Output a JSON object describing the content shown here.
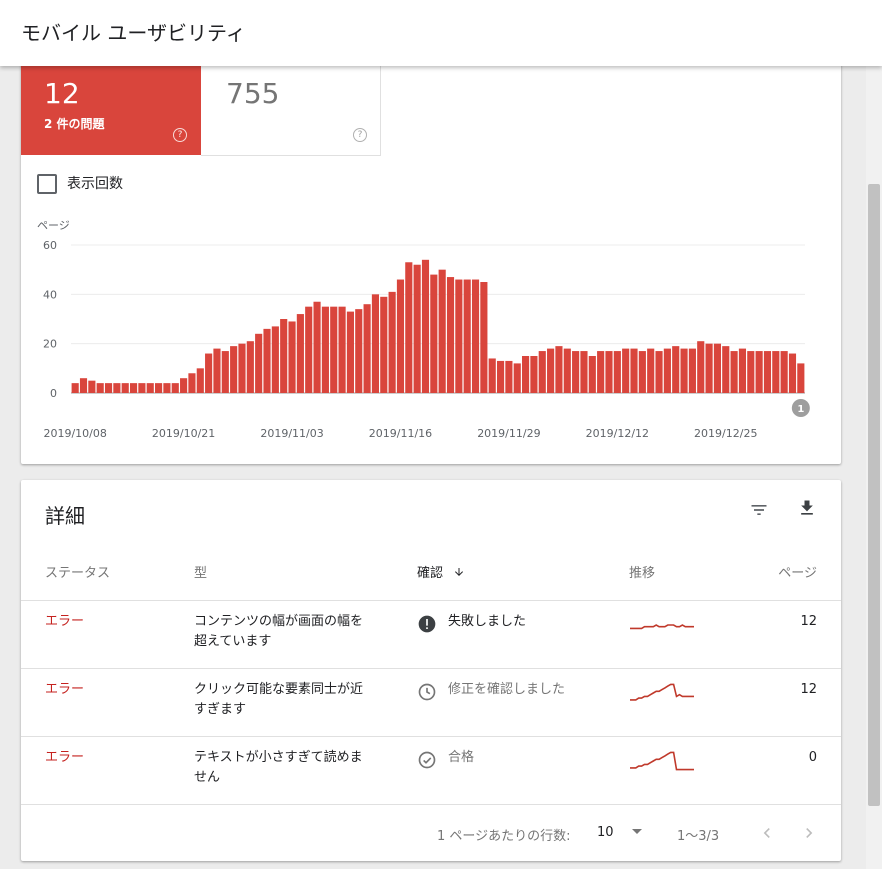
{
  "header": {
    "title": "モバイル ユーザビリティ"
  },
  "summary": {
    "error_count": "12",
    "error_label": "2 件の問題",
    "valid_count": "755",
    "help_glyph": "?"
  },
  "toggle": {
    "impressions_label": "表示回数",
    "checked": false
  },
  "chart_data": {
    "type": "bar",
    "ylabel": "ページ",
    "ylim": [
      0,
      60
    ],
    "yticks": [
      0,
      20,
      40,
      60
    ],
    "xticks": [
      {
        "label": "2019/10/08",
        "index": 0
      },
      {
        "label": "2019/10/21",
        "index": 13
      },
      {
        "label": "2019/11/03",
        "index": 26
      },
      {
        "label": "2019/11/16",
        "index": 39
      },
      {
        "label": "2019/11/29",
        "index": 52
      },
      {
        "label": "2019/12/12",
        "index": 65
      },
      {
        "label": "2019/12/25",
        "index": 78
      }
    ],
    "values": [
      4,
      6,
      5,
      4,
      4,
      4,
      4,
      4,
      4,
      4,
      4,
      4,
      4,
      6,
      8,
      10,
      16,
      18,
      17,
      19,
      20,
      21,
      24,
      26,
      27,
      30,
      29,
      32,
      35,
      37,
      35,
      35,
      35,
      33,
      34,
      36,
      40,
      39,
      41,
      46,
      53,
      52,
      54,
      48,
      50,
      47,
      46,
      46,
      46,
      45,
      14,
      13,
      13,
      12,
      15,
      15,
      17,
      18,
      19,
      18,
      17,
      17,
      15,
      17,
      17,
      17,
      18,
      18,
      17,
      18,
      17,
      18,
      19,
      18,
      18,
      21,
      20,
      20,
      19,
      17,
      18,
      17,
      17,
      17,
      17,
      17,
      16,
      12
    ],
    "annotation": "1",
    "annotation_index": 87,
    "color": "#d9453c"
  },
  "details": {
    "title": "詳細",
    "columns": {
      "status": "ステータス",
      "type": "型",
      "validation": "確認",
      "trend": "推移",
      "pages": "ページ"
    },
    "rows": [
      {
        "status": "エラー",
        "type": "コンテンツの幅が画面の幅を超えています",
        "validation": "失敗しました",
        "validation_icon": "error-filled-icon",
        "pages": "12"
      },
      {
        "status": "エラー",
        "type": "クリック可能な要素同士が近すぎます",
        "validation": "修正を確認しました",
        "validation_icon": "clock-icon",
        "pages": "12"
      },
      {
        "status": "エラー",
        "type": "テキストが小さすぎて読めません",
        "validation": "合格",
        "validation_icon": "check-circle-icon",
        "pages": "0"
      }
    ],
    "sparklines": [
      [
        5,
        5,
        5,
        5,
        5,
        6,
        6,
        6,
        6,
        7,
        6,
        6,
        6,
        7,
        7,
        7,
        6,
        6,
        7,
        6,
        6,
        6,
        6
      ],
      [
        3,
        3,
        3,
        4,
        4,
        5,
        5,
        6,
        7,
        8,
        8,
        9,
        10,
        11,
        12,
        12,
        5,
        6,
        5,
        5,
        5,
        5,
        5
      ],
      [
        3,
        3,
        3,
        4,
        4,
        5,
        5,
        6,
        7,
        8,
        8,
        9,
        10,
        11,
        12,
        12,
        2,
        2,
        2,
        2,
        2,
        2,
        2
      ]
    ],
    "pagination": {
      "rows_per_page_label": "1 ページあたりの行数:",
      "rows_per_page": "10",
      "range": "1〜3/3"
    }
  },
  "colors": {
    "accent": "#d9453c",
    "error_text": "#c5221f",
    "sparkline": "#c0392b"
  }
}
